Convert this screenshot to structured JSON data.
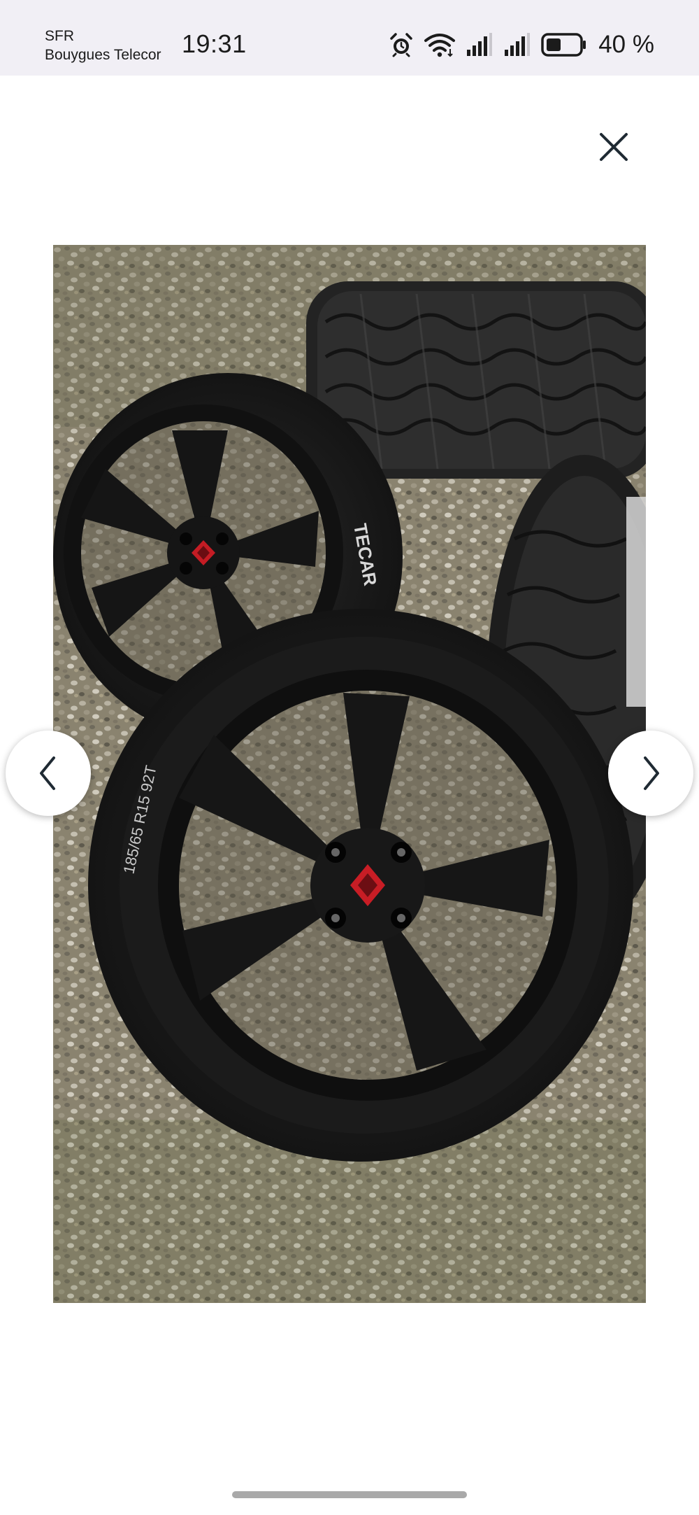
{
  "status_bar": {
    "carrier_1": "SFR",
    "carrier_2": "Bouygues Telecor",
    "time": "19:31",
    "battery_percent": "40 %",
    "icons": [
      "alarm-icon",
      "wifi-icon",
      "signal-icon",
      "signal-icon",
      "battery-icon"
    ]
  },
  "viewer": {
    "close_icon": "close-icon",
    "prev_icon": "chevron-left-icon",
    "next_icon": "chevron-right-icon",
    "photo_alt": "Black alloy wheels with winter tires on gravel",
    "tire_brand_text": "TECAR",
    "tire_sidewall_text": "185/65 R15 92T"
  }
}
